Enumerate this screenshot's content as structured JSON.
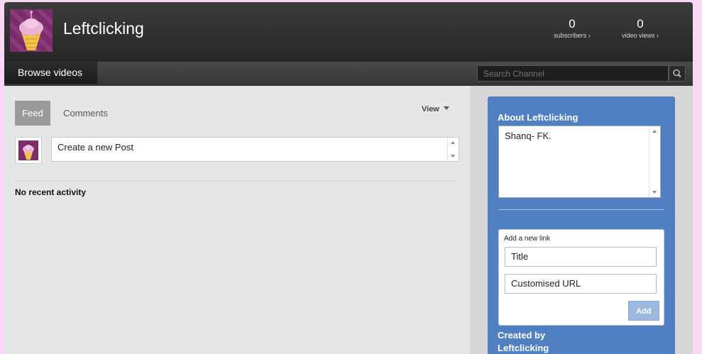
{
  "header": {
    "channel_name": "Leftclicking",
    "subscribers": {
      "count": "0",
      "label": "subscribers ›"
    },
    "video_views": {
      "count": "0",
      "label": "video views ›"
    }
  },
  "nav": {
    "browse_label": "Browse videos",
    "search_placeholder": "Search Channel"
  },
  "feed": {
    "tabs": [
      {
        "label": "Feed",
        "active": true
      },
      {
        "label": "Comments",
        "active": false
      }
    ],
    "view_label": "View",
    "post_placeholder": "Create a new Post",
    "empty_message": "No recent activity"
  },
  "about": {
    "title": "About Leftclicking",
    "description": "Shanq- FK.",
    "add_link_label": "Add a new link",
    "title_placeholder": "Title",
    "url_placeholder": "Customised URL",
    "add_button": "Add",
    "created_by_label": "Created by",
    "created_by_name": "Leftclicking"
  },
  "colors": {
    "page_bg": "#f7d9f4",
    "header_bg": "#2a2a2a",
    "about_bg": "#5080c2",
    "active_tab": "#9a9a9a"
  },
  "icons": [
    "cupcake-avatar-icon",
    "search-icon",
    "chevron-down-icon"
  ]
}
